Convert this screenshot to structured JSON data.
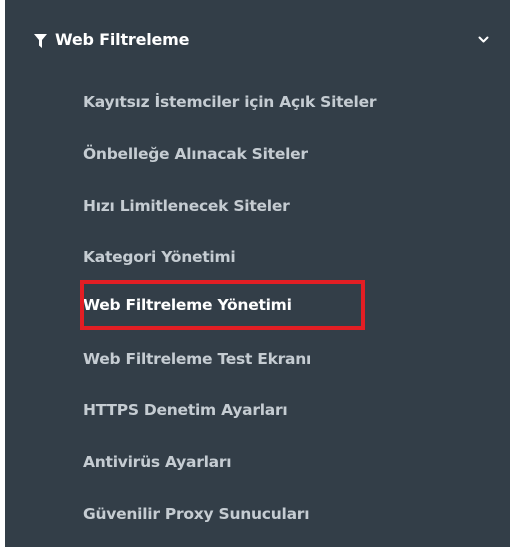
{
  "sidebar": {
    "section": {
      "title": "Web Filtreleme",
      "icon": "filter-icon",
      "expanded": true,
      "chevron_icon": "chevron-down-icon"
    },
    "items": [
      {
        "label": "Kayıtsız İstemciler için Açık Siteler"
      },
      {
        "label": "Önbelleğe Alınacak Siteler"
      },
      {
        "label": "Hızı Limitlenecek Siteler"
      },
      {
        "label": "Kategori Yönetimi"
      },
      {
        "label": "Web Filtreleme Yönetimi",
        "active": true
      },
      {
        "label": "Web Filtreleme Test Ekranı"
      },
      {
        "label": "HTTPS Denetim Ayarları"
      },
      {
        "label": "Antivirüs Ayarları"
      },
      {
        "label": "Güvenilir Proxy Sunucuları"
      }
    ]
  },
  "colors": {
    "sidebar_background": "#333e48",
    "item_text": "#c5ccd2",
    "active_text": "#ffffff",
    "highlight_border": "#e31e24"
  }
}
